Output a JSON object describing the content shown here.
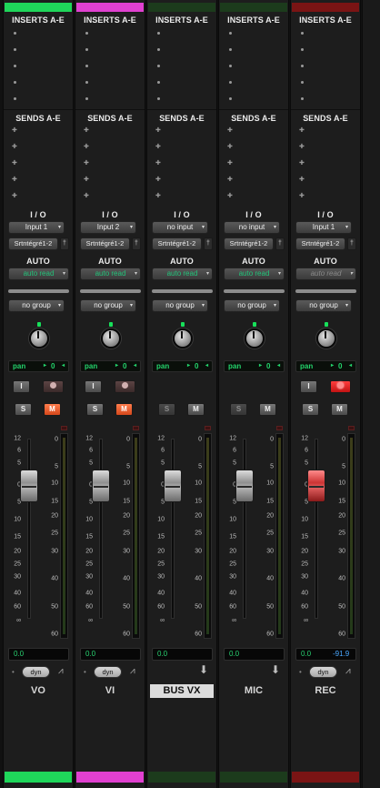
{
  "mixer": {
    "sections": {
      "inserts": "INSERTS A-E",
      "sends": "SENDS A-E",
      "io": "I / O",
      "auto": "AUTO"
    },
    "scale_left": [
      "12",
      "6",
      "5",
      "0",
      "5",
      "10",
      "15",
      "20",
      "25",
      "30",
      "40",
      "60",
      "∞"
    ],
    "scale_right": [
      "0",
      "5",
      "10",
      "15",
      "20",
      "25",
      "30",
      "40",
      "50",
      "60"
    ],
    "strips": [
      {
        "name": "VO",
        "color": "#1fd65a",
        "input": "Input 1",
        "output": "Srtntégré1-2",
        "output_pin": "†",
        "automation": "auto read",
        "automation_dim": false,
        "group": "no group",
        "pan": {
          "label": "pan",
          "value": "0"
        },
        "input_btn": "I",
        "rec_btn": "",
        "rec_armed": false,
        "solo": "S",
        "mute": "M",
        "mute_on": true,
        "volume": "0.0",
        "peak": "",
        "dyn": "dyn",
        "selected": false,
        "dim_buttons": false
      },
      {
        "name": "VI",
        "color": "#e040d0",
        "input": "Input 2",
        "output": "Srtntégré1-2",
        "output_pin": "†",
        "automation": "auto read",
        "automation_dim": false,
        "group": "no group",
        "pan": {
          "label": "pan",
          "value": "0"
        },
        "input_btn": "I",
        "rec_btn": "",
        "rec_armed": false,
        "solo": "S",
        "mute": "M",
        "mute_on": true,
        "volume": "0.0",
        "peak": "",
        "dyn": "dyn",
        "selected": false,
        "dim_buttons": false
      },
      {
        "name": "BUS VX",
        "color": "#1c3b1c",
        "input": "no input",
        "output": "Srtntégré1-2",
        "output_pin": "†",
        "automation": "auto read",
        "automation_dim": false,
        "group": "no group",
        "pan": {
          "label": "pan",
          "value": "0"
        },
        "input_btn": "",
        "rec_btn": "",
        "rec_armed": false,
        "solo": "S",
        "mute": "M",
        "mute_on": false,
        "volume": "0.0",
        "peak": "",
        "dyn": "",
        "selected": true,
        "dim_buttons": true
      },
      {
        "name": "MIC",
        "color": "#1c3b1c",
        "input": "no input",
        "output": "Srtntégré1-2",
        "output_pin": "†",
        "automation": "auto read",
        "automation_dim": false,
        "group": "no group",
        "pan": {
          "label": "pan",
          "value": "0"
        },
        "input_btn": "",
        "rec_btn": "",
        "rec_armed": false,
        "solo": "S",
        "mute": "M",
        "mute_on": false,
        "volume": "0.0",
        "peak": "",
        "dyn": "",
        "selected": false,
        "dim_buttons": true
      },
      {
        "name": "REC",
        "color": "#7a1414",
        "input": "Input 1",
        "output": "Srtntégré1-2",
        "output_pin": "†",
        "automation": "auto read",
        "automation_dim": true,
        "group": "no group",
        "pan": {
          "label": "pan",
          "value": "0"
        },
        "input_btn": "I",
        "rec_btn": "",
        "rec_armed": true,
        "solo": "S",
        "mute": "M",
        "mute_on": false,
        "volume": "0.0",
        "peak": "-91.9",
        "dyn": "dyn",
        "selected": false,
        "dim_buttons": false
      }
    ]
  }
}
